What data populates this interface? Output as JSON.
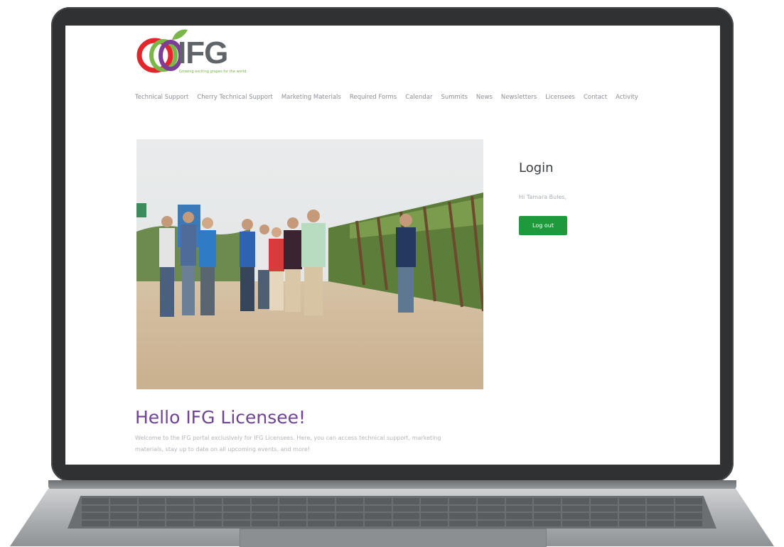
{
  "site": {
    "logo_text": "IFG",
    "tagline": "Growing exciting grapes for the world",
    "brand_colors": {
      "red": "#e2262b",
      "green": "#7ab648",
      "purple": "#7b3f98",
      "gray": "#5f6469"
    }
  },
  "nav": {
    "items": [
      "Technical Support",
      "Cherry Technical Support",
      "Marketing Materials",
      "Required Forms",
      "Calendar",
      "Summits",
      "News",
      "Newsletters",
      "Licensees",
      "Contact",
      "Activity"
    ]
  },
  "login": {
    "title": "Login",
    "greeting": "Hi Tamara Bules,",
    "logout_label": "Log out",
    "button_color": "#1e9a3d"
  },
  "welcome": {
    "heading": "Hello IFG Licensee!",
    "text": "Welcome to the IFG portal exclusively for IFG Licensees. Here, you can access technical support, marketing materials, stay up to date on all upcoming events, and more!"
  }
}
